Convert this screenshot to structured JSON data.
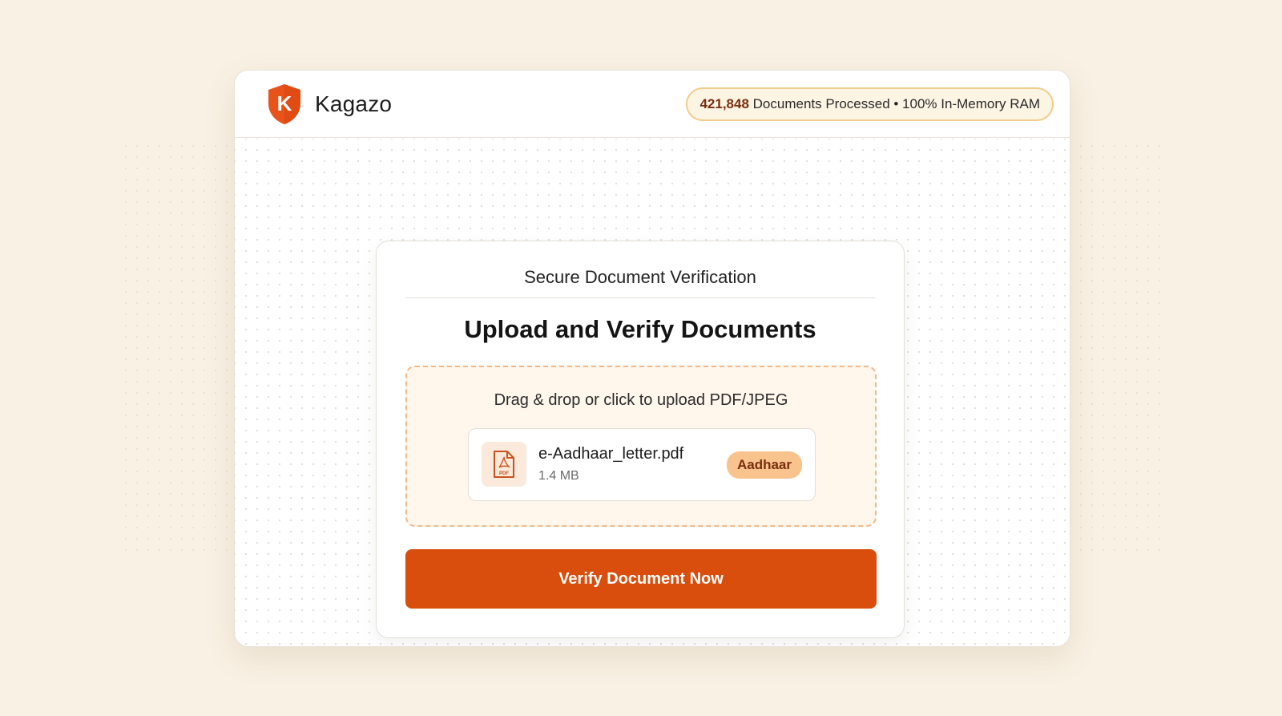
{
  "header": {
    "brand_name": "Kagazo",
    "logo_letter": "K",
    "stats": {
      "count": "421,848",
      "label": "Documents Processed • 100% In-Memory RAM"
    }
  },
  "card": {
    "subtitle": "Secure Document Verification",
    "title": "Upload and Verify Documents",
    "dropzone": {
      "instruction": "Drag & drop or click to upload PDF/JPEG",
      "file": {
        "icon": "pdf-file-icon",
        "icon_label": "PDF",
        "name": "e-Aadhaar_letter.pdf",
        "size": "1.4 MB",
        "badge": "Aadhaar"
      }
    },
    "verify_button_label": "Verify Document Now"
  },
  "colors": {
    "accent": "#d94d0d",
    "logo": "#e8531a",
    "badge_bg": "#f9c38e",
    "badge_text": "#7a2e0e",
    "stats_border": "#f0cd8c",
    "page_bg": "#f9f1e4"
  }
}
